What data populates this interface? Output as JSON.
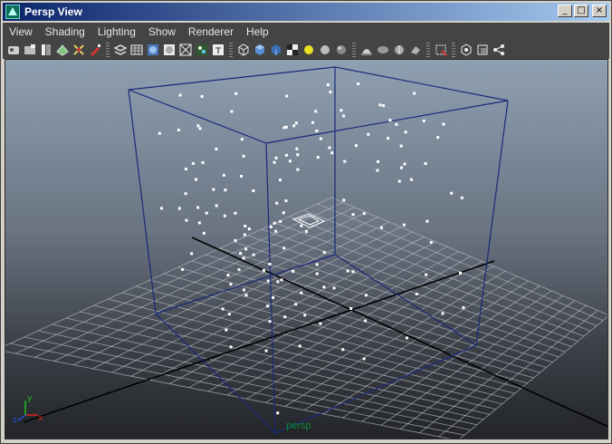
{
  "window": {
    "title": "Persp View",
    "controls": {
      "minimize": "_",
      "maximize": "□",
      "close": "×"
    }
  },
  "menu": [
    {
      "name": "menu-view",
      "label": "View"
    },
    {
      "name": "menu-shading",
      "label": "Shading"
    },
    {
      "name": "menu-lighting",
      "label": "Lighting"
    },
    {
      "name": "menu-show",
      "label": "Show"
    },
    {
      "name": "menu-renderer",
      "label": "Renderer"
    },
    {
      "name": "menu-help",
      "label": "Help"
    }
  ],
  "toolbar_icons": [
    "select-camera-icon",
    "camera-attributes-icon",
    "bookmarks-icon",
    "image-plane-icon",
    "two-d-pan-zoom-icon",
    "grease-pencil-icon",
    "|",
    "wireframe-on-shaded-icon",
    "grid-icon",
    "shaded-sphere-icon",
    "textured-icon",
    "xray-icon",
    "isolate-icon",
    "text-resolution-icon",
    "|",
    "wireframe-icon",
    "smooth-shade-all-icon",
    "flat-shade-icon",
    "checker-texture-icon",
    "use-default-light-icon",
    "all-lights-icon",
    "shadows-icon",
    "|",
    "screen-space-ao-icon",
    "motion-blur-icon",
    "multisample-icon",
    "depth-of-field-icon",
    "|",
    "isolate-select-icon",
    "|",
    "xray-joints-icon",
    "xray-active-icon",
    "hud-icon"
  ],
  "viewport": {
    "camera_name": "persp",
    "axis_labels": {
      "x": "x",
      "y": "y",
      "z": "z"
    }
  }
}
